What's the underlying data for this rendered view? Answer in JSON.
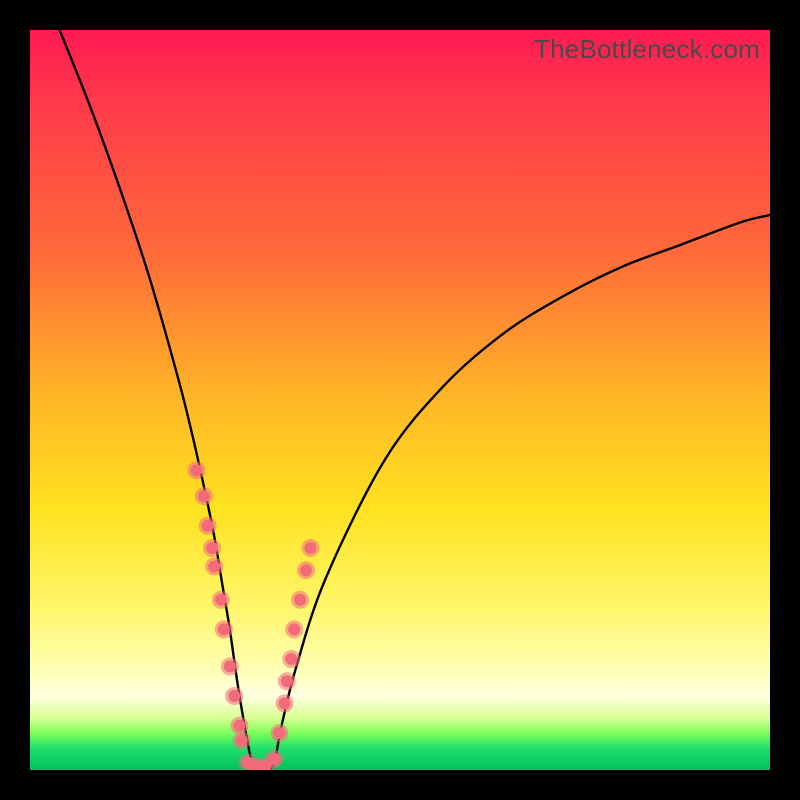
{
  "watermark": "TheBottleneck.com",
  "chart_data": {
    "type": "line",
    "title": "",
    "xlabel": "",
    "ylabel": "",
    "xlim": [
      0,
      100
    ],
    "ylim": [
      0,
      100
    ],
    "grid": false,
    "series": [
      {
        "name": "bottleneck-curve",
        "x": [
          4,
          8,
          12,
          16,
          20,
          22,
          24,
          25,
          26,
          27,
          28,
          29,
          30,
          31,
          32,
          33,
          34,
          36,
          40,
          48,
          56,
          64,
          72,
          80,
          88,
          96,
          100
        ],
        "values": [
          100,
          90,
          79,
          67,
          53,
          45,
          36,
          31,
          25,
          19,
          12,
          6,
          1,
          0,
          0,
          1,
          6,
          14,
          26,
          42,
          52,
          59,
          64,
          68,
          71,
          74,
          75
        ]
      }
    ],
    "dots": {
      "name": "sample-points",
      "color": "#f36b7a",
      "radius_outer": 9,
      "radius_inner": 6,
      "x": [
        22.5,
        23.5,
        24.0,
        24.6,
        24.9,
        25.8,
        26.2,
        27.0,
        27.6,
        28.3,
        28.6,
        29.4,
        30.5,
        31.8,
        33.0,
        33.7,
        34.4,
        34.7,
        35.3,
        35.7,
        36.5,
        37.3,
        37.9
      ],
      "values": [
        40.5,
        37.0,
        33.0,
        30.0,
        27.5,
        23.0,
        19.0,
        14.0,
        10.0,
        6.0,
        4.0,
        1.0,
        0.5,
        0.5,
        1.5,
        5.0,
        9.0,
        12.0,
        15.0,
        19.0,
        23.0,
        27.0,
        30.0
      ]
    }
  }
}
